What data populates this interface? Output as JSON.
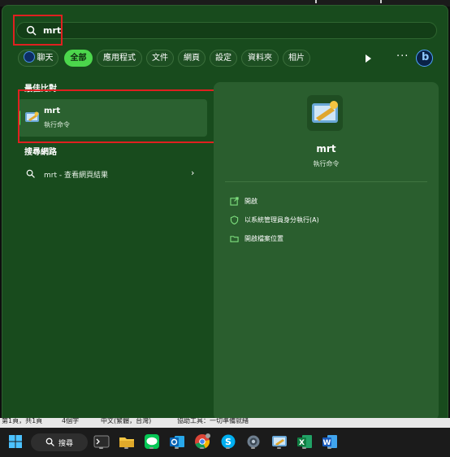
{
  "search": {
    "query": "mrt"
  },
  "filters": [
    {
      "label": "聊天",
      "active": false,
      "bing": true
    },
    {
      "label": "全部",
      "active": true
    },
    {
      "label": "應用程式",
      "active": false
    },
    {
      "label": "文件",
      "active": false
    },
    {
      "label": "網頁",
      "active": false
    },
    {
      "label": "設定",
      "active": false
    },
    {
      "label": "資料夾",
      "active": false
    },
    {
      "label": "相片",
      "active": false
    }
  ],
  "results": {
    "best_match_title": "最佳比對",
    "best_match": {
      "name": "mrt",
      "type": "執行命令"
    },
    "web_title": "搜尋網路",
    "web_item": "mrt - 查看網頁結果"
  },
  "detail": {
    "name": "mrt",
    "type": "執行命令",
    "actions": [
      {
        "label": "開啟",
        "icon": "open-icon"
      },
      {
        "label": "以系統管理員身分執行(A)",
        "icon": "shield-icon"
      },
      {
        "label": "開啟檔案位置",
        "icon": "folder-icon"
      }
    ]
  },
  "status_strip": [
    "第1頁，共1頁",
    "4個字",
    "中文(繁體，台灣)",
    "協助工具：一切準備就緒"
  ],
  "taskbar": {
    "search_label": "搜尋",
    "apps": [
      "start-icon",
      "terminal-icon",
      "file-explorer-icon",
      "line-icon",
      "outlook-icon",
      "chrome-icon",
      "skype-icon",
      "settings-icon",
      "control-panel-icon",
      "excel-icon",
      "word-icon"
    ]
  },
  "colors": {
    "accent": "#4cd64c",
    "panel": "#184b1d",
    "highlight": "#e02020"
  }
}
